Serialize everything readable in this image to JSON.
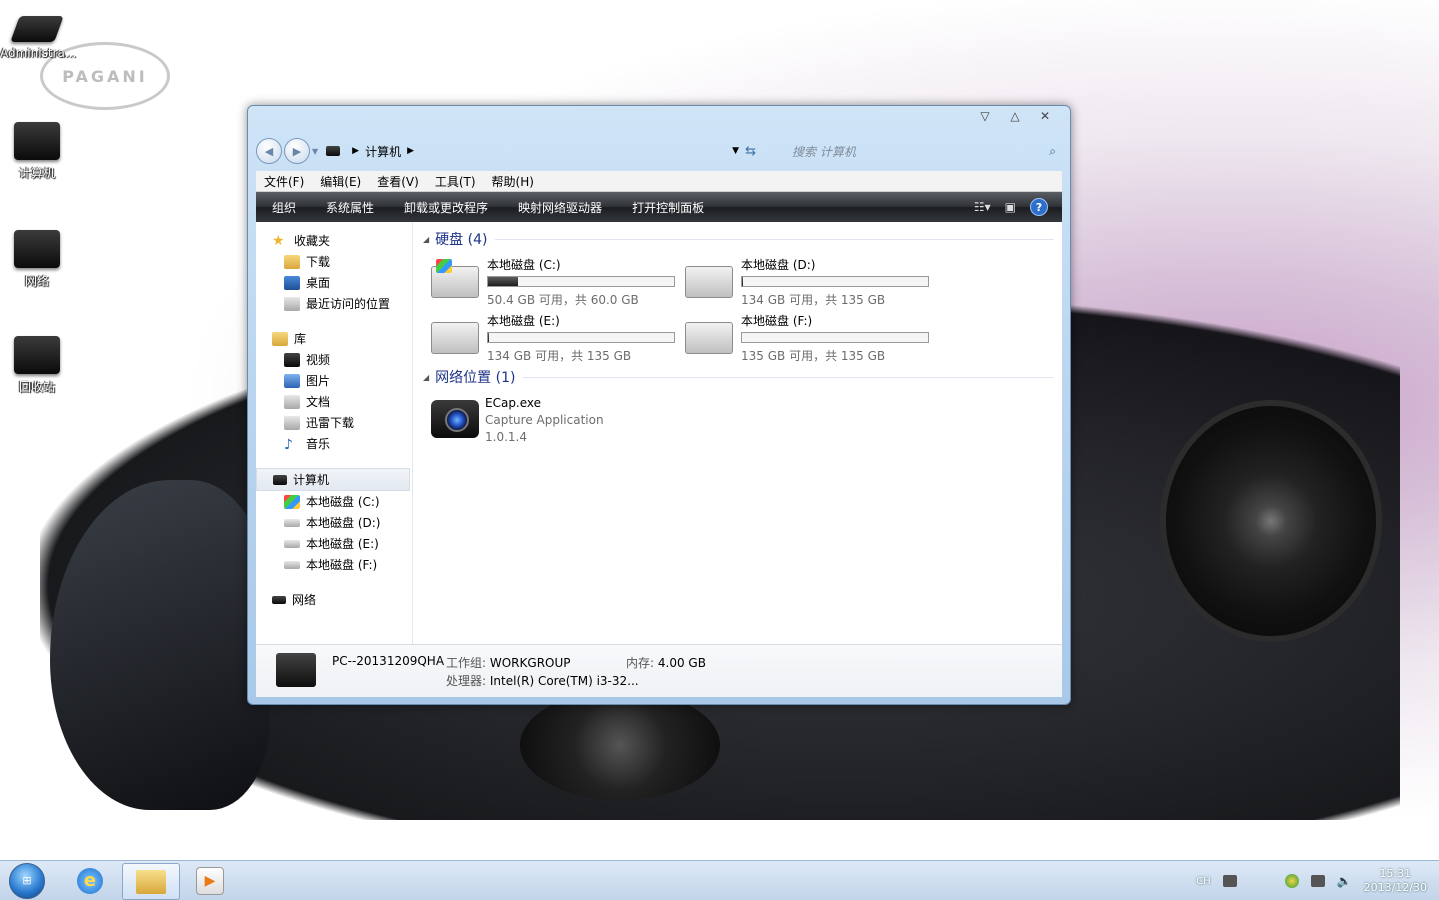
{
  "desktop": {
    "logo_text": "PAGANI",
    "icons": [
      {
        "label": "Administra..."
      },
      {
        "label": "计算机"
      },
      {
        "label": "网络"
      },
      {
        "label": "回收站"
      }
    ]
  },
  "window": {
    "controls": {
      "minimize": "▽",
      "maximize": "△",
      "close": "✕"
    },
    "address": {
      "root": "计算机"
    },
    "search": {
      "placeholder": "搜索 计算机"
    },
    "menu": [
      "文件(F)",
      "编辑(E)",
      "查看(V)",
      "工具(T)",
      "帮助(H)"
    ],
    "toolbar": [
      "组织",
      "系统属性",
      "卸载或更改程序",
      "映射网络驱动器",
      "打开控制面板"
    ],
    "nav": {
      "favorites": {
        "label": "收藏夹",
        "items": [
          "下载",
          "桌面",
          "最近访问的位置"
        ]
      },
      "library": {
        "label": "库",
        "items": [
          "视频",
          "图片",
          "文档",
          "迅雷下载",
          "音乐"
        ]
      },
      "computer": {
        "label": "计算机",
        "items": [
          "本地磁盘 (C:)",
          "本地磁盘 (D:)",
          "本地磁盘 (E:)",
          "本地磁盘 (F:)"
        ]
      },
      "network": {
        "label": "网络"
      }
    },
    "sections": {
      "drives_header": "硬盘 (4)",
      "network_header": "网络位置 (1)"
    },
    "drives": [
      {
        "name": "本地磁盘 (C:)",
        "free": "50.4 GB 可用，共 60.0 GB",
        "used_fraction": 0.16
      },
      {
        "name": "本地磁盘 (D:)",
        "free": "134 GB 可用，共 135 GB",
        "used_fraction": 0.007
      },
      {
        "name": "本地磁盘 (E:)",
        "free": "134 GB 可用，共 135 GB",
        "used_fraction": 0.007
      },
      {
        "name": "本地磁盘 (F:)",
        "free": "135 GB 可用，共 135 GB",
        "used_fraction": 0.0
      }
    ],
    "network_item": {
      "name": "ECap.exe",
      "desc": "Capture Application",
      "version": "1.0.1.4"
    },
    "details": {
      "pc_name": "PC--20131209QHA",
      "workgroup_label": "工作组:",
      "workgroup": "WORKGROUP",
      "memory_label": "内存:",
      "memory": "4.00 GB",
      "cpu_label": "处理器:",
      "cpu": "Intel(R) Core(TM) i3-32..."
    }
  },
  "taskbar": {
    "lang": "CH",
    "time": "15:31",
    "date": "2013/12/30"
  }
}
